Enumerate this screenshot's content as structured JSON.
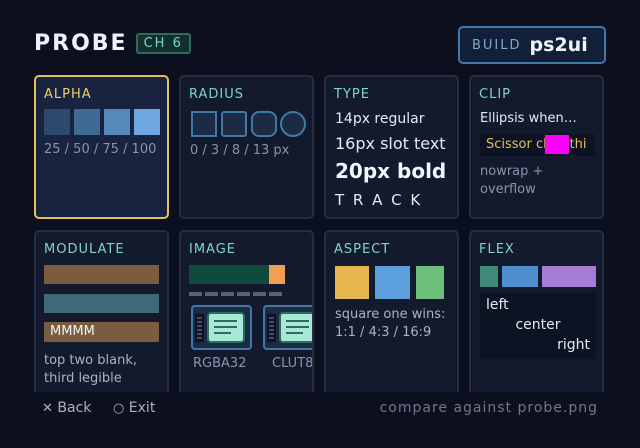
{
  "header": {
    "title": "PROBE",
    "channel": "CH 6",
    "build_label": "BUILD",
    "build_value": "ps2ui"
  },
  "cards": {
    "alpha": {
      "title": "ALPHA",
      "text": "25 / 50 / 75 / 100",
      "colors": [
        "#2d4a6c",
        "#3f6a93",
        "#5789bb",
        "#6fa8e0"
      ]
    },
    "radius": {
      "title": "RADIUS",
      "text": "0 / 3 / 8 / 13 px"
    },
    "type": {
      "title": "TYPE",
      "line1": "14px regular",
      "line2": "16px slot text",
      "line3": "20px bold",
      "line4": "T R A C K"
    },
    "clip": {
      "title": "CLIP",
      "ellipsis": "Ellipsis when…",
      "scissor": "Scissor clips thi",
      "note": "nowrap + overflow"
    },
    "modulate": {
      "title": "MODULATE",
      "bar3_text": "MMMM",
      "note": "top two blank, third legible"
    },
    "image": {
      "title": "IMAGE",
      "icon1_label": "RGBA32",
      "icon2_label": "CLUT8",
      "bar_fill": 0.875
    },
    "aspect": {
      "title": "ASPECT",
      "note": "square one wins: 1:1 / 4:3 / 16:9"
    },
    "flex": {
      "title": "FLEX",
      "left": "left",
      "center": "center",
      "right": "right"
    }
  },
  "footer": {
    "back": "Back",
    "exit": "Exit",
    "note": "compare against probe.png"
  },
  "colors": {
    "accent": "#7ed6c4",
    "selected": "#e7bf5a",
    "magenta": "#ff00ff"
  }
}
